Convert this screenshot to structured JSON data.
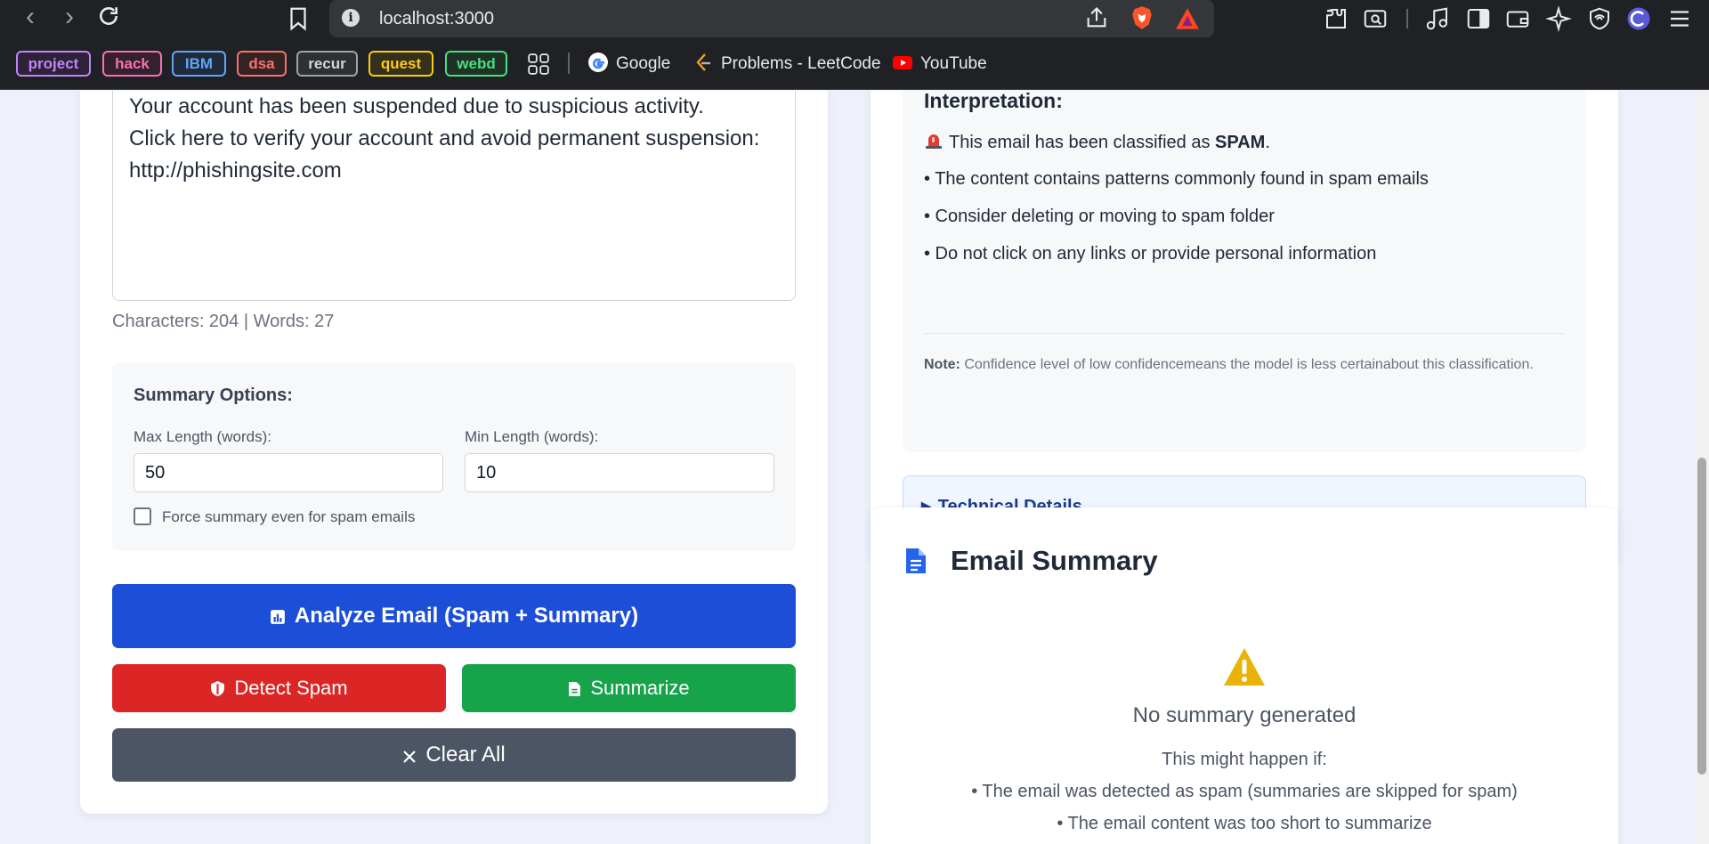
{
  "browser": {
    "url": "localhost:3000",
    "bookmark_tags": [
      {
        "label": "project",
        "color": "#c084fc"
      },
      {
        "label": "hack",
        "color": "#f472b6"
      },
      {
        "label": "IBM",
        "color": "#60a5fa"
      },
      {
        "label": "dsa",
        "color": "#f87171"
      },
      {
        "label": "recur",
        "color": "#9ca3af"
      },
      {
        "label": "quest",
        "color": "#facc15"
      },
      {
        "label": "webd",
        "color": "#4ade80"
      }
    ],
    "bookmark_links": [
      {
        "label": "Google"
      },
      {
        "label": "Problems - LeetCode"
      },
      {
        "label": "YouTube"
      }
    ]
  },
  "input": {
    "email_lines": [
      "Your account has been suspended due to suspicious activity.",
      "Click here to verify your account and avoid permanent suspension:",
      "http://phishingsite.com"
    ],
    "counter": "Characters: 204 | Words: 27"
  },
  "options": {
    "title": "Summary Options:",
    "max_label": "Max Length (words):",
    "max_value": "50",
    "min_label": "Min Length (words):",
    "min_value": "10",
    "force_label": "Force summary even for spam emails",
    "force_checked": false
  },
  "buttons": {
    "analyze": "Analyze Email (Spam + Summary)",
    "detect": "Detect Spam",
    "summarize": "Summarize",
    "clear": "Clear All"
  },
  "interpretation": {
    "title": "Interpretation:",
    "classified_prefix": "This email has been classified as",
    "classification": "SPAM",
    "classified_suffix": ".",
    "bullets": [
      "• The content contains patterns commonly found in spam emails",
      "• Consider deleting or moving to spam folder",
      "• Do not click on any links or provide personal information"
    ],
    "note_label": "Note:",
    "note_text": "Confidence level of low confidencemeans the model is less certainabout this classification.",
    "technical_details": "Technical Details"
  },
  "summary": {
    "title": "Email Summary",
    "empty_title": "No summary generated",
    "empty_intro": "This might happen if:",
    "reasons": [
      "• The email was detected as spam (summaries are skipped for spam)",
      "• The email content was too short to summarize"
    ]
  },
  "colors": {
    "primary": "#1d4ed8",
    "danger": "#dc2626",
    "success": "#16a34a",
    "neutral": "#4b5563",
    "warning": "#eab308"
  }
}
